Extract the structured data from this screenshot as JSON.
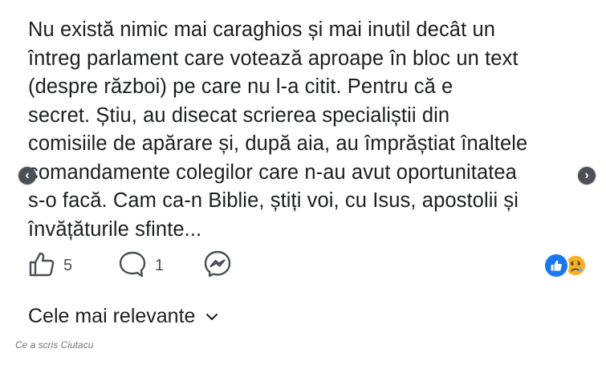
{
  "post": {
    "lines": [
      "Nu există nimic mai caraghios și mai inutil decât un",
      "întreg parlament care votează aproape în bloc un text",
      "(despre război) pe care nu l-a citit. Pentru că e",
      "secret. Știu, au disecat scrierea specialiștii din",
      "comisiile de apărare și, după aia, au împrăștiat înaltele",
      "comandamente colegilor care n-au avut oportunitatea",
      "s-o facă. Cam ca-n Biblie, știți voi, cu Isus, apostolii și",
      "învățăturile sfinte..."
    ]
  },
  "actions": {
    "like_count": "5",
    "comment_count": "1",
    "like_icon": "thumbs-up-outline-icon",
    "comment_icon": "speech-bubble-icon",
    "messenger_icon": "messenger-icon"
  },
  "reactions": {
    "icons": [
      "like-reaction-icon",
      "sad-reaction-icon"
    ],
    "like_color": "#1877f2",
    "sad_color": "#f7b125"
  },
  "comments": {
    "sort_label": "Cele mai relevante",
    "sort_icon": "chevron-down-icon"
  },
  "caption": "Ce a scris Ciutacu"
}
